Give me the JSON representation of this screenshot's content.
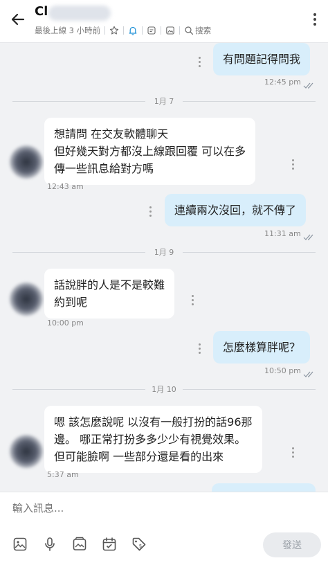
{
  "header": {
    "contact_name": "Cl",
    "last_seen": "最後上線 3 小時前",
    "search_label": "搜索",
    "icons": [
      "back-arrow-icon",
      "star-icon",
      "bell-icon",
      "note-icon",
      "image-icon",
      "search-icon",
      "more-vertical-icon"
    ]
  },
  "colors": {
    "outgoing_bubble": "#d8eefb",
    "incoming_bubble": "#ffffff",
    "accent": "#1a8fd6"
  },
  "messages": [
    {
      "dir": "out",
      "text": "有問題記得問我",
      "time": "12:45 pm"
    },
    {
      "date": "1月 7"
    },
    {
      "dir": "in",
      "text": "想請問 在交友軟體聊天\n但好幾天對方都沒上線跟回覆 可以在多\n傳一些訊息給對方嗎",
      "time": "12:43 am"
    },
    {
      "dir": "out",
      "text": "連續兩次沒回，就不傳了",
      "time": "11:31 am"
    },
    {
      "date": "1月 9"
    },
    {
      "dir": "in",
      "text": "話說胖的人是不是較難\n約到呢",
      "time": "10:00 pm"
    },
    {
      "dir": "out",
      "text": "怎麼樣算胖呢？",
      "time": "10:50 pm"
    },
    {
      "date": "1月 10"
    },
    {
      "dir": "in",
      "text": "嗯 該怎麼說呢 以沒有一般打扮的話96那\n邊。 哪正常打扮多多少少有視覺效果。\n但可能臉啊 一些部分還是看的出來",
      "time": "5:37 am"
    }
  ],
  "composer": {
    "placeholder": "輸入訊息...",
    "send_label": "發送",
    "tools": [
      "image-icon",
      "microphone-icon",
      "gallery-icon",
      "calendar-icon",
      "price-tag-icon"
    ]
  }
}
